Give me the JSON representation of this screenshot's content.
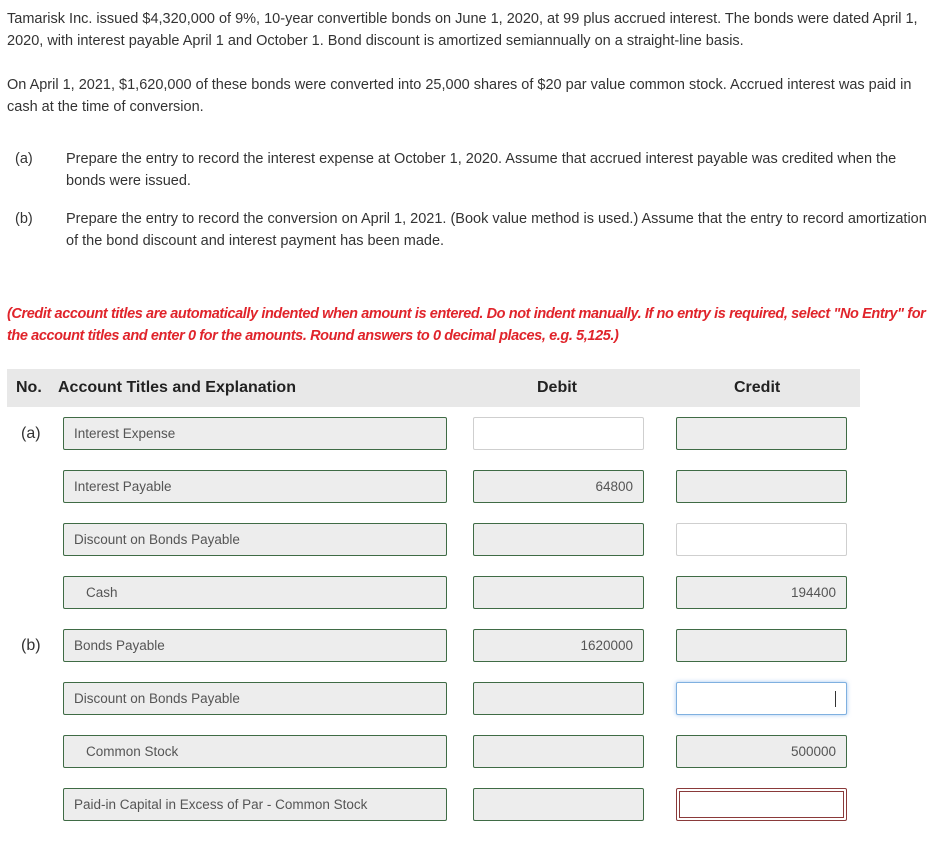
{
  "problem": {
    "paragraph1": "Tamarisk Inc. issued $4,320,000 of 9%, 10-year convertible bonds on June 1, 2020, at 99 plus accrued interest. The bonds were dated April 1, 2020, with interest payable April 1 and October 1. Bond discount is amortized semiannually on a straight-line basis.",
    "paragraph2": "On April 1, 2021, $1,620,000 of these bonds were converted into 25,000 shares of $20 par value common stock. Accrued interest was paid in cash at the time of conversion.",
    "questions": [
      {
        "label": "(a)",
        "text": "Prepare the entry to record the interest expense at October 1, 2020. Assume that accrued interest payable was credited when the bonds were issued."
      },
      {
        "label": "(b)",
        "text": "Prepare the entry to record the conversion on April 1, 2021. (Book value method is used.) Assume that the entry to record amortization of the bond discount and interest payment has been made."
      }
    ],
    "instructions": "(Credit account titles are automatically indented when amount is entered. Do not indent manually. If no entry is required, select \"No Entry\" for the account titles and enter 0 for the amounts. Round answers to 0 decimal places, e.g. 5,125.)"
  },
  "table": {
    "headers": {
      "no": "No.",
      "account": "Account Titles and Explanation",
      "debit": "Debit",
      "credit": "Credit"
    },
    "rows": [
      {
        "no": "(a)",
        "account": "Interest Expense",
        "debit": "",
        "credit": ""
      },
      {
        "no": "",
        "account": "Interest Payable",
        "debit": "64800",
        "credit": ""
      },
      {
        "no": "",
        "account": "Discount on Bonds Payable",
        "debit": "",
        "credit": ""
      },
      {
        "no": "",
        "account": "Cash",
        "debit": "",
        "credit": "194400"
      },
      {
        "no": "(b)",
        "account": "Bonds Payable",
        "debit": "1620000",
        "credit": ""
      },
      {
        "no": "",
        "account": "Discount on Bonds Payable",
        "debit": "",
        "credit": ""
      },
      {
        "no": "",
        "account": "Common Stock",
        "debit": "",
        "credit": "500000"
      },
      {
        "no": "",
        "account": "Paid-in Capital in Excess of Par - Common Stock",
        "debit": "",
        "credit": ""
      }
    ]
  },
  "colors": {
    "instruction_red": "#e0242b",
    "field_border_green": "#3f6b45",
    "field_bg": "#ededed",
    "header_bg": "#e8e8e8",
    "error_border": "#8a3a3a",
    "focus_border": "#7fb0e0"
  }
}
